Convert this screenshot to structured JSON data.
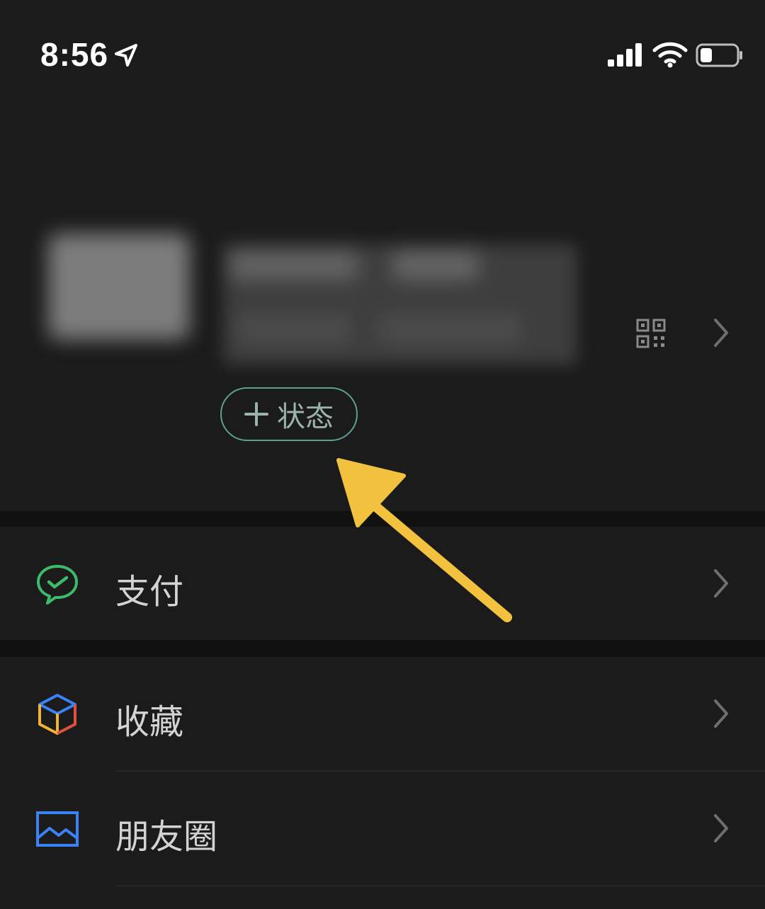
{
  "status_bar": {
    "time": "8:56",
    "icons": [
      "location-arrow-icon",
      "signal-icon",
      "wifi-icon",
      "battery-icon"
    ]
  },
  "profile": {
    "avatar": "blurred",
    "name": "blurred",
    "status_button_label": "状态",
    "icons": [
      "qr-code-icon",
      "chevron-right-icon"
    ]
  },
  "menu": {
    "items": [
      {
        "label": "支付",
        "icon": "wechat-pay-icon"
      },
      {
        "label": "收藏",
        "icon": "favorites-cube-icon"
      },
      {
        "label": "朋友圈",
        "icon": "moments-picture-icon"
      }
    ]
  },
  "colors": {
    "background": "#1b1b1b",
    "separator": "#111111",
    "status_button_border": "#5f9e93",
    "status_button_text": "#9ab3ad",
    "pay_green": "#3ebb6a",
    "moments_blue": "#3b82f6",
    "annotation_arrow": "#f2c23e"
  }
}
